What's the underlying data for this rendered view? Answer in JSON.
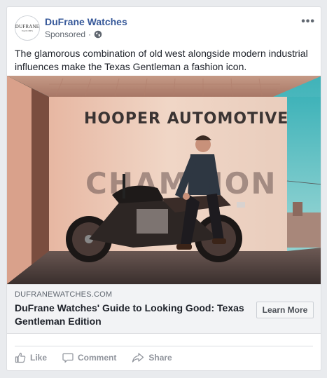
{
  "post": {
    "page_name": "DuFrane Watches",
    "avatar_logo": "DUFRANE",
    "avatar_sub": "WATCHES",
    "sponsored_label": "Sponsored",
    "separator": "·",
    "more_icon": "more-options-icon",
    "text": "The glamorous combination of old west alongside modern industrial influences make the Texas Gentleman a fashion icon."
  },
  "image": {
    "sign_text": "HOOPER AUTOMOTIVE",
    "wall_text": "CHAMPION"
  },
  "link": {
    "domain": "DUFRANEWATCHES.COM",
    "headline": "DuFrane Watches' Guide to Looking Good: Texas Gentleman Edition",
    "cta_label": "Learn More"
  },
  "actions": {
    "like": "Like",
    "comment": "Comment",
    "share": "Share"
  },
  "colors": {
    "page_name": "#365899",
    "background": "#e9ebee",
    "link_area": "#f2f3f5",
    "action_text": "#90949c"
  }
}
